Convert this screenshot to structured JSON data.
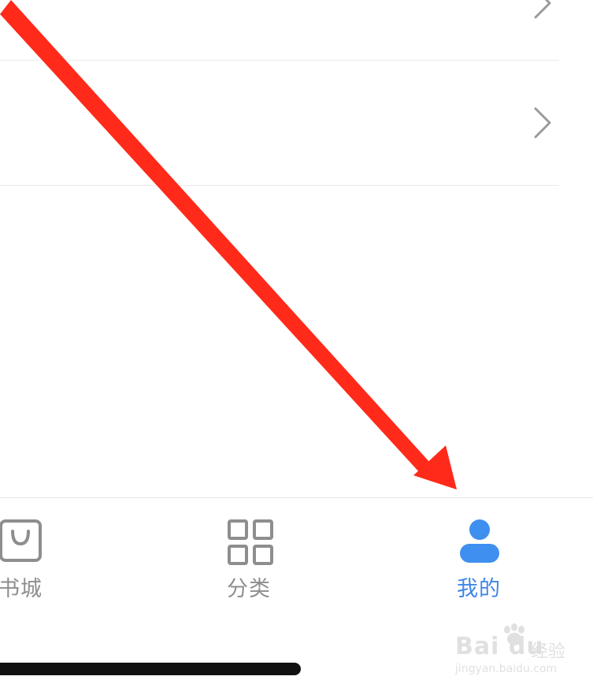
{
  "tabbar": {
    "tabs": [
      {
        "label": "书城",
        "icon": "shopping-bag-icon",
        "active": false
      },
      {
        "label": "分类",
        "icon": "grid-icon",
        "active": false
      },
      {
        "label": "我的",
        "icon": "user-icon",
        "active": true
      }
    ]
  },
  "list": {
    "rows": [
      {
        "icon": "chevron-right-icon"
      },
      {
        "icon": "chevron-right-icon"
      }
    ]
  },
  "annotation": {
    "icon": "red-arrow-icon",
    "color": "#ff2a1a"
  },
  "watermark": {
    "brand": "Bai du",
    "brand_cn": "经验",
    "url": "jingyan.baidu.com"
  },
  "colors": {
    "active_tab": "#3f86e6",
    "inactive_tab": "#8e8e8e",
    "divider": "#e9e9e9",
    "chevron": "#9a9a9a"
  }
}
